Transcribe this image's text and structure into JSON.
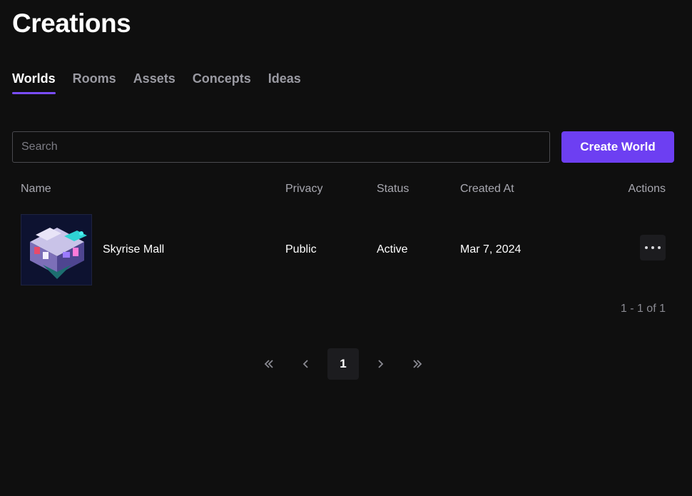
{
  "header": {
    "title": "Creations"
  },
  "tabs": [
    {
      "label": "Worlds",
      "active": true
    },
    {
      "label": "Rooms",
      "active": false
    },
    {
      "label": "Assets",
      "active": false
    },
    {
      "label": "Concepts",
      "active": false
    },
    {
      "label": "Ideas",
      "active": false
    }
  ],
  "search": {
    "placeholder": "Search",
    "value": ""
  },
  "create_button": {
    "label": "Create World"
  },
  "table": {
    "columns": [
      "Name",
      "Privacy",
      "Status",
      "Created At",
      "Actions"
    ],
    "rows": [
      {
        "name": "Skyrise Mall",
        "privacy": "Public",
        "status": "Active",
        "created_at": "Mar 7, 2024",
        "thumbnail_icon": "world-thumbnail-image"
      }
    ]
  },
  "pagination": {
    "range_text": "1 - 1 of 1",
    "current_page": "1",
    "icons": [
      "first-page-icon",
      "prev-page-icon",
      "next-page-icon",
      "last-page-icon"
    ]
  },
  "colors": {
    "background": "#0f0f0f",
    "accent": "#6d3ff2",
    "tab_underline": "#7a4dff",
    "muted_text": "#9a9aa2"
  }
}
